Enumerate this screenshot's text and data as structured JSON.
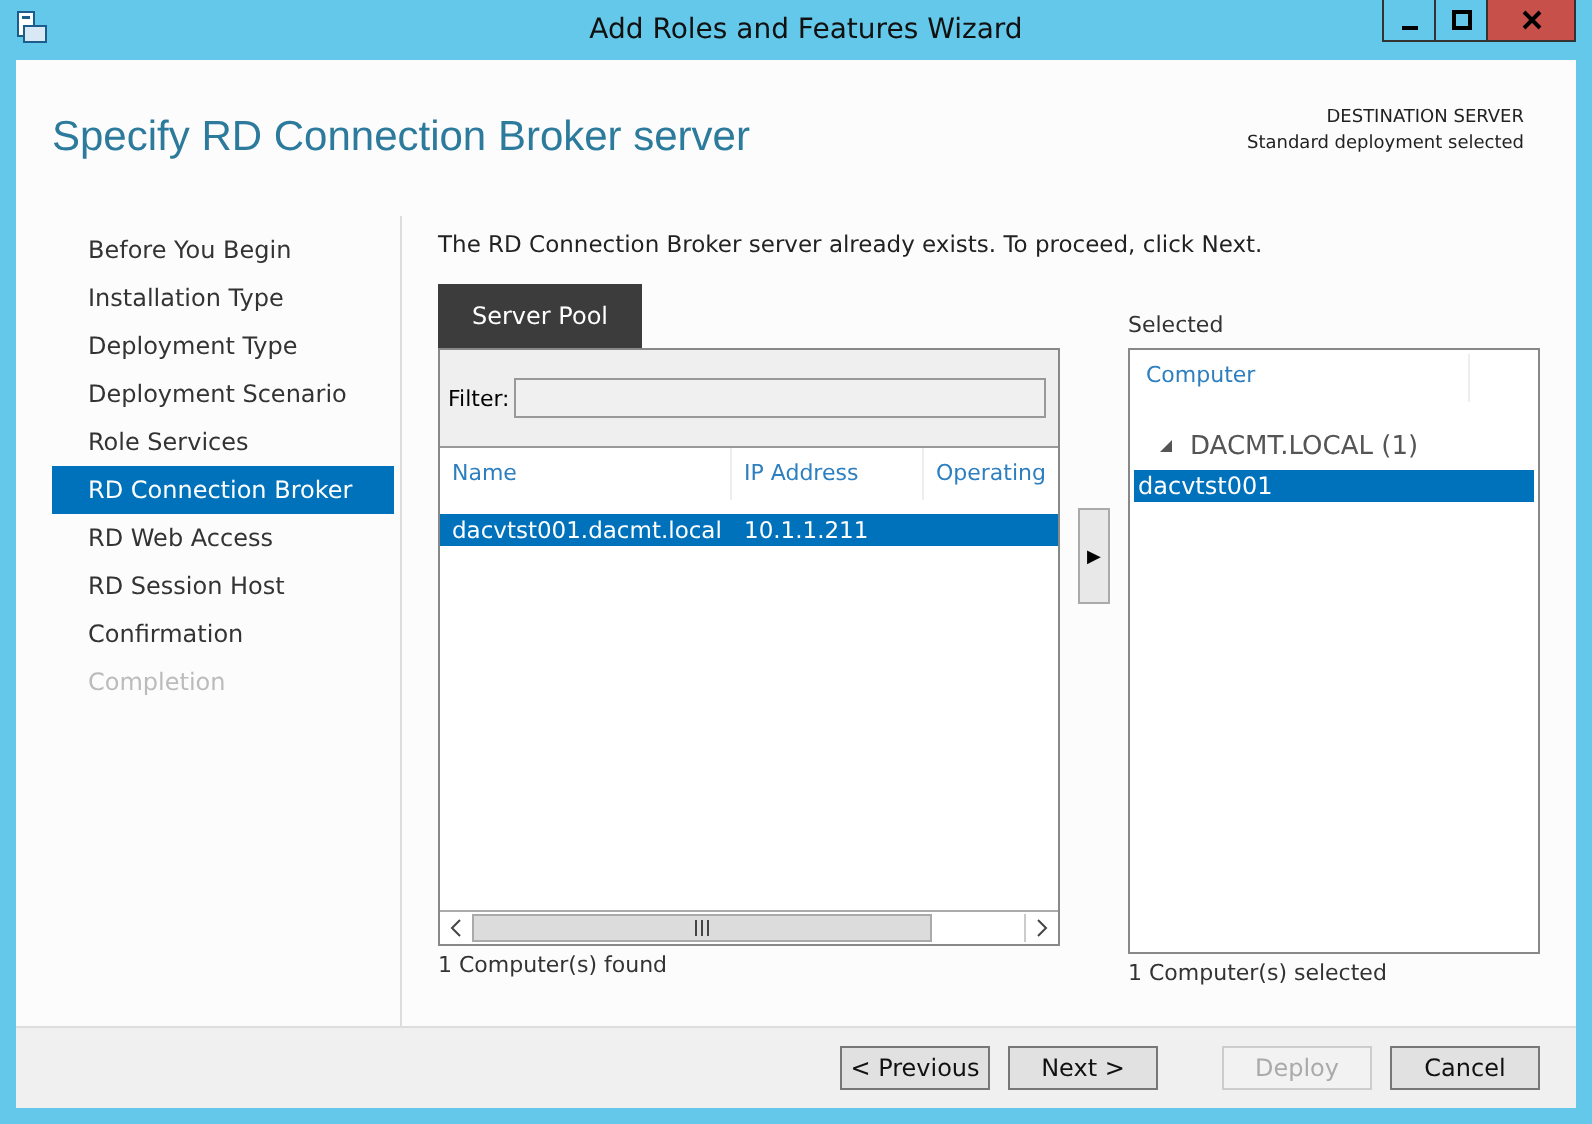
{
  "window": {
    "title": "Add Roles and Features Wizard"
  },
  "header": {
    "title": "Specify RD Connection Broker server",
    "destination_label": "DESTINATION SERVER",
    "destination_value": "Standard deployment selected"
  },
  "steps": [
    {
      "label": "Before You Begin",
      "selected": false,
      "disabled": false
    },
    {
      "label": "Installation Type",
      "selected": false,
      "disabled": false
    },
    {
      "label": "Deployment Type",
      "selected": false,
      "disabled": false
    },
    {
      "label": "Deployment Scenario",
      "selected": false,
      "disabled": false
    },
    {
      "label": "Role Services",
      "selected": false,
      "disabled": false
    },
    {
      "label": "RD Connection Broker",
      "selected": true,
      "disabled": false
    },
    {
      "label": "RD Web Access",
      "selected": false,
      "disabled": false
    },
    {
      "label": "RD Session Host",
      "selected": false,
      "disabled": false
    },
    {
      "label": "Confirmation",
      "selected": false,
      "disabled": false
    },
    {
      "label": "Completion",
      "selected": false,
      "disabled": true
    }
  ],
  "message": "The RD Connection Broker server already exists. To proceed, click Next.",
  "server_pool": {
    "tab": "Server Pool",
    "filter_label": "Filter:",
    "columns": [
      "Name",
      "IP Address",
      "Operating"
    ],
    "rows": [
      {
        "cells": [
          "dacvtst001.dacmt.local",
          "10.1.1.211"
        ],
        "selected": true
      }
    ],
    "status": "1 Computer(s) found"
  },
  "add_button": "▶",
  "selected_panel": {
    "label": "Selected",
    "column": "Computer",
    "group": {
      "label": "DACMT.LOCAL (1)",
      "expanded": true,
      "children": [
        {
          "label": "dacvtst001",
          "selected": true
        }
      ]
    },
    "status": "1 Computer(s) selected"
  },
  "buttons": [
    {
      "label": "< Previous",
      "disabled": false
    },
    {
      "label": "Next >",
      "disabled": false
    },
    {
      "label": "Deploy",
      "disabled": true
    },
    {
      "label": "Cancel",
      "disabled": false
    }
  ]
}
